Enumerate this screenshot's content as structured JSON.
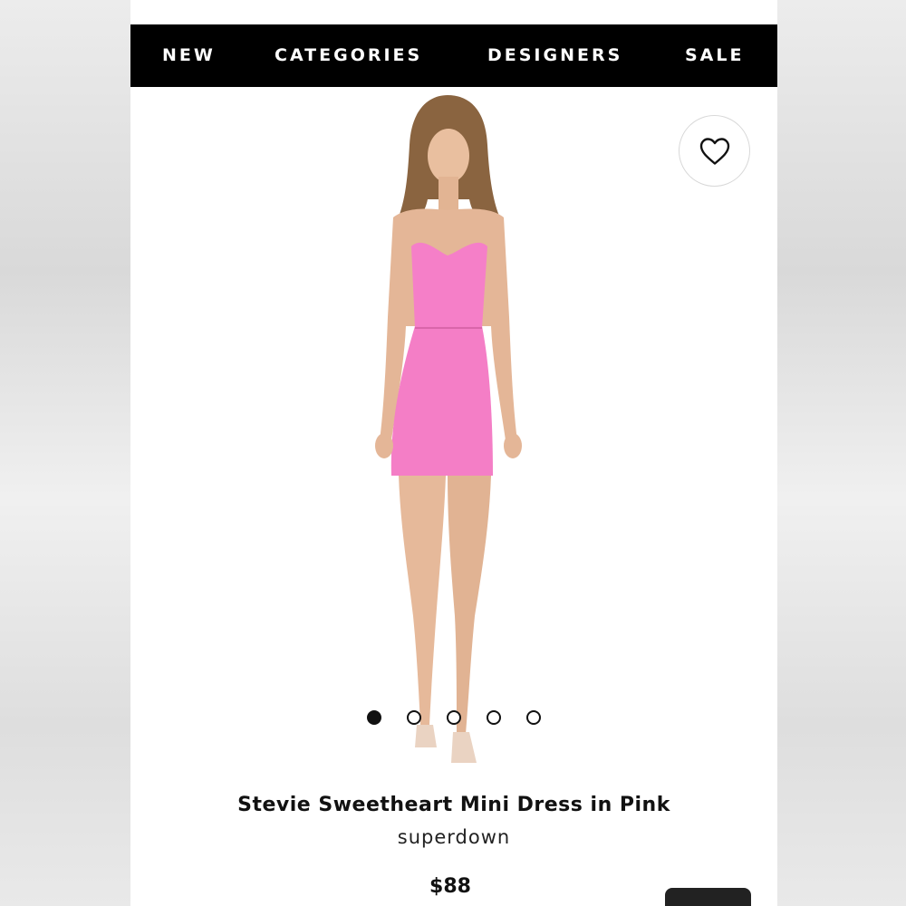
{
  "nav": {
    "items": [
      "NEW",
      "CATEGORIES",
      "DESIGNERS",
      "SALE"
    ]
  },
  "favorite": {
    "icon": "heart-icon"
  },
  "gallery": {
    "image_count": 5,
    "active_index": 0
  },
  "product": {
    "title": "Stevie Sweetheart Mini Dress in Pink",
    "brand": "superdown",
    "price": "$88"
  },
  "colors": {
    "nav_bg": "#000000",
    "dress": "#f57fc8",
    "skin": "#e6b99a"
  }
}
